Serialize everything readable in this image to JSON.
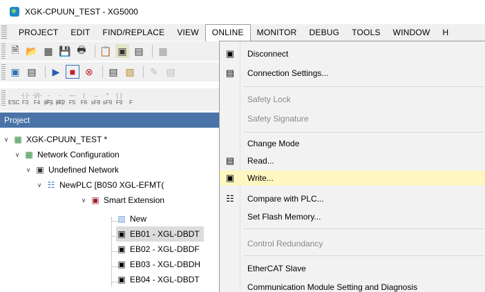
{
  "window": {
    "title": "XGK-CPUUN_TEST - XG5000"
  },
  "menubar": {
    "items": [
      "PROJECT",
      "EDIT",
      "FIND/REPLACE",
      "VIEW",
      "ONLINE",
      "MONITOR",
      "DEBUG",
      "TOOLS",
      "WINDOW",
      "H"
    ],
    "active": "ONLINE"
  },
  "toolbar3": {
    "keys": [
      {
        "glyph": "",
        "label": "ESC"
      },
      {
        "glyph": "-| |-",
        "label": "F3"
      },
      {
        "glyph": "-|/|-",
        "label": "F4"
      },
      {
        "glyph": "-|P|-",
        "label": "sF1"
      },
      {
        "glyph": "-|N|-",
        "label": "sF2"
      },
      {
        "glyph": "—",
        "label": "F5"
      },
      {
        "glyph": "|",
        "label": "F6"
      },
      {
        "glyph": "→",
        "label": "sF8"
      },
      {
        "glyph": "*",
        "label": "sF9"
      },
      {
        "glyph": "( )",
        "label": "F9"
      },
      {
        "glyph": "",
        "label": "F"
      }
    ]
  },
  "project_panel": {
    "header": "Project",
    "tree": {
      "root": "XGK-CPUUN_TEST *",
      "network_config": "Network Configuration",
      "undefined_network": "Undefined Network",
      "plc": "NewPLC [B0S0 XGL-EFMT(",
      "smart_extension": "Smart Extension",
      "new": "New",
      "eb01": "EB01 - XGL-DBDT",
      "eb02": "EB02 - XGL-DBDF",
      "eb03": "EB03 - XGL-DBDH",
      "eb04": "EB04 - XGL-DBDT"
    }
  },
  "online_menu": {
    "disconnect": "Disconnect",
    "connection_settings": "Connection Settings...",
    "safety_lock": "Safety Lock",
    "safety_signature": "Safety Signature",
    "change_mode": "Change Mode",
    "read": "Read...",
    "write": "Write...",
    "compare": "Compare with PLC...",
    "set_flash": "Set Flash Memory...",
    "control_redundancy": "Control Redundancy",
    "ethercat_slave": "EtherCAT Slave",
    "comm_module": "Communication Module Setting and Diagnosis"
  }
}
